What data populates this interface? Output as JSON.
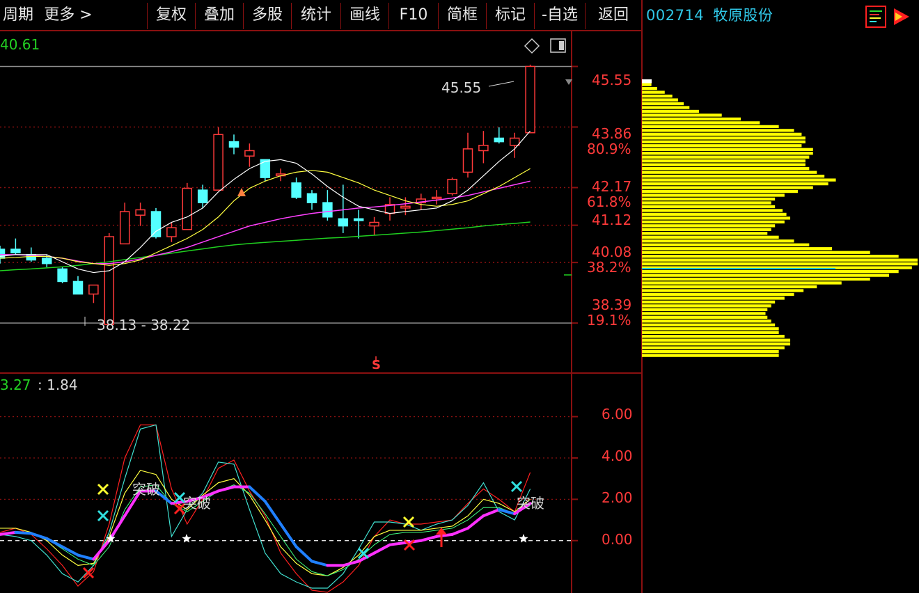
{
  "toolbar": {
    "period": "周期",
    "more": "更多 >",
    "items": [
      "复权",
      "叠加",
      "多股",
      "统计",
      "画线",
      "F10",
      "简框",
      "标记",
      "-自选",
      "返回"
    ]
  },
  "stock": {
    "code": "002714",
    "name": "牧原股份"
  },
  "main_panel": {
    "current_value": "40.61",
    "high_annotation": "45.55",
    "low_annotation": "38.13 - 38.22",
    "signal_mark": "S"
  },
  "price_axis": [
    {
      "value": "45.55",
      "pct": ""
    },
    {
      "value": "43.86",
      "pct": "80.9%"
    },
    {
      "value": "42.17",
      "pct": "61.8%"
    },
    {
      "value": "41.12",
      "pct": ""
    },
    {
      "value": "40.08",
      "pct": "38.2%"
    },
    {
      "value": "38.39",
      "pct": "19.1%"
    }
  ],
  "indicator_panel": {
    "value1": "3.27",
    "value2": ": 1.84",
    "axis": [
      "6.00",
      "4.00",
      "2.00",
      "0.00"
    ],
    "signals": [
      "突破",
      "突破",
      "突破"
    ]
  },
  "colors": {
    "up": "#ff3a3a",
    "down": "#54ffff",
    "ma5": "#ffffff",
    "ma10": "#ffff40",
    "ma20": "#ff40ff",
    "ma60": "#20d020",
    "volume_profile": "#ffff00",
    "grid": "#8a1010"
  },
  "chart_data": {
    "type": "candlestick",
    "ylim": [
      37.5,
      46.2
    ],
    "candles": [
      {
        "o": 40.45,
        "h": 40.55,
        "l": 40.05,
        "c": 40.2
      },
      {
        "o": 40.45,
        "h": 40.75,
        "l": 40.3,
        "c": 40.35
      },
      {
        "o": 40.3,
        "h": 40.5,
        "l": 40.1,
        "c": 40.15
      },
      {
        "o": 40.2,
        "h": 40.3,
        "l": 39.95,
        "c": 40.05
      },
      {
        "o": 39.9,
        "h": 39.95,
        "l": 39.5,
        "c": 39.55
      },
      {
        "o": 39.55,
        "h": 39.7,
        "l": 39.2,
        "c": 39.2
      },
      {
        "o": 39.2,
        "h": 39.45,
        "l": 38.95,
        "c": 39.45
      },
      {
        "o": 38.35,
        "h": 40.9,
        "l": 38.35,
        "c": 40.8
      },
      {
        "o": 40.6,
        "h": 41.75,
        "l": 40.6,
        "c": 41.5
      },
      {
        "o": 41.4,
        "h": 41.75,
        "l": 41.1,
        "c": 41.55
      },
      {
        "o": 41.5,
        "h": 41.6,
        "l": 40.75,
        "c": 40.8
      },
      {
        "o": 40.8,
        "h": 41.2,
        "l": 40.65,
        "c": 41.05
      },
      {
        "o": 41.0,
        "h": 42.3,
        "l": 41.0,
        "c": 42.15
      },
      {
        "o": 42.1,
        "h": 42.25,
        "l": 41.6,
        "c": 41.75
      },
      {
        "o": 42.1,
        "h": 43.85,
        "l": 42.1,
        "c": 43.65
      },
      {
        "o": 43.45,
        "h": 43.65,
        "l": 43.1,
        "c": 43.3
      },
      {
        "o": 43.05,
        "h": 43.4,
        "l": 42.75,
        "c": 43.2
      },
      {
        "o": 42.95,
        "h": 42.95,
        "l": 42.35,
        "c": 42.45
      },
      {
        "o": 42.5,
        "h": 42.7,
        "l": 42.35,
        "c": 42.55
      },
      {
        "o": 42.3,
        "h": 42.45,
        "l": 41.85,
        "c": 41.9
      },
      {
        "o": 42.0,
        "h": 42.1,
        "l": 41.55,
        "c": 41.75
      },
      {
        "o": 41.75,
        "h": 42.1,
        "l": 41.25,
        "c": 41.35
      },
      {
        "o": 41.3,
        "h": 42.25,
        "l": 40.9,
        "c": 41.1
      },
      {
        "o": 41.3,
        "h": 41.55,
        "l": 40.75,
        "c": 41.25
      },
      {
        "o": 41.1,
        "h": 41.35,
        "l": 40.85,
        "c": 41.2
      },
      {
        "o": 41.45,
        "h": 41.9,
        "l": 41.25,
        "c": 41.7
      },
      {
        "o": 41.6,
        "h": 41.9,
        "l": 41.4,
        "c": 41.65
      },
      {
        "o": 41.75,
        "h": 42.0,
        "l": 41.55,
        "c": 41.85
      },
      {
        "o": 41.9,
        "h": 42.1,
        "l": 41.7,
        "c": 41.9
      },
      {
        "o": 42.0,
        "h": 42.45,
        "l": 41.95,
        "c": 42.4
      },
      {
        "o": 42.6,
        "h": 43.7,
        "l": 42.45,
        "c": 43.25
      },
      {
        "o": 43.2,
        "h": 43.75,
        "l": 42.85,
        "c": 43.35
      },
      {
        "o": 43.55,
        "h": 43.85,
        "l": 43.4,
        "c": 43.45
      },
      {
        "o": 43.35,
        "h": 43.7,
        "l": 43.0,
        "c": 43.55
      },
      {
        "o": 43.7,
        "h": 45.6,
        "l": 43.7,
        "c": 45.55
      }
    ],
    "ma5": [
      40.25,
      40.3,
      40.3,
      40.3,
      40.1,
      39.9,
      39.8,
      39.85,
      40.1,
      40.5,
      40.95,
      41.2,
      41.35,
      41.6,
      42.05,
      42.4,
      42.7,
      42.9,
      42.95,
      42.85,
      42.55,
      42.2,
      41.9,
      41.65,
      41.55,
      41.45,
      41.5,
      41.55,
      41.6,
      41.8,
      42.1,
      42.5,
      42.9,
      43.25,
      43.75
    ],
    "ma10": [
      40.2,
      40.22,
      40.25,
      40.25,
      40.2,
      40.1,
      40.05,
      40.0,
      40.05,
      40.15,
      40.35,
      40.55,
      40.75,
      41.0,
      41.35,
      41.8,
      42.15,
      42.35,
      42.5,
      42.6,
      42.65,
      42.6,
      42.45,
      42.3,
      42.1,
      41.95,
      41.8,
      41.7,
      41.65,
      41.7,
      41.8,
      42.0,
      42.2,
      42.45,
      42.7
    ],
    "ma20": [
      40.3,
      40.3,
      40.28,
      40.25,
      40.2,
      40.12,
      40.05,
      40.05,
      40.1,
      40.18,
      40.28,
      40.38,
      40.5,
      40.65,
      40.8,
      40.95,
      41.1,
      41.2,
      41.3,
      41.38,
      41.45,
      41.5,
      41.55,
      41.6,
      41.63,
      41.67,
      41.72,
      41.77,
      41.82,
      41.88,
      41.95,
      42.05,
      42.15,
      42.25,
      42.35
    ],
    "ma60": [
      39.85,
      39.88,
      39.9,
      39.93,
      39.96,
      40.0,
      40.05,
      40.1,
      40.16,
      40.22,
      40.28,
      40.34,
      40.4,
      40.46,
      40.52,
      40.57,
      40.61,
      40.64,
      40.67,
      40.7,
      40.73,
      40.76,
      40.78,
      40.81,
      40.84,
      40.87,
      40.9,
      40.93,
      40.97,
      41.01,
      41.05,
      41.1,
      41.14,
      41.17,
      41.21
    ],
    "indicator": {
      "ylim": [
        -2.4,
        7.3
      ],
      "main": [
        0.3,
        0.4,
        0.35,
        0.1,
        -0.3,
        -0.7,
        -0.9,
        0.0,
        1.2,
        2.4,
        2.4,
        1.8,
        1.9,
        2.1,
        2.4,
        2.6,
        2.6,
        1.9,
        0.8,
        -0.3,
        -1.0,
        -1.2,
        -1.2,
        -1.0,
        -0.6,
        -0.2,
        -0.1,
        0.0,
        0.2,
        0.3,
        0.6,
        1.2,
        1.5,
        1.3,
        1.8
      ],
      "red": [
        0.4,
        0.6,
        0.3,
        -0.4,
        -1.2,
        -2.2,
        -1.5,
        0.8,
        4.0,
        5.6,
        5.6,
        2.5,
        0.8,
        2.0,
        3.5,
        3.9,
        2.4,
        1.2,
        -0.6,
        -1.6,
        -2.4,
        -2.5,
        -2.0,
        -1.2,
        0.2,
        1.0,
        0.8,
        0.8,
        0.9,
        1.0,
        1.8,
        2.5,
        2.0,
        1.4,
        3.3
      ],
      "cyan": [
        0.3,
        0.2,
        0.0,
        -0.7,
        -1.6,
        -2.0,
        -1.2,
        0.4,
        3.0,
        5.4,
        5.6,
        0.2,
        1.5,
        2.3,
        3.8,
        3.7,
        1.5,
        -0.6,
        -1.6,
        -2.0,
        -2.3,
        -2.3,
        -1.6,
        -0.4,
        0.9,
        0.9,
        0.8,
        0.5,
        0.8,
        1.0,
        1.7,
        2.8,
        1.4,
        1.0,
        2.5
      ],
      "yellow": [
        0.6,
        0.6,
        0.4,
        0.0,
        -0.7,
        -1.2,
        -1.1,
        0.2,
        2.3,
        3.4,
        3.2,
        2.0,
        1.5,
        2.2,
        2.8,
        3.0,
        2.2,
        1.0,
        -0.3,
        -1.1,
        -1.6,
        -1.7,
        -1.3,
        -0.7,
        0.2,
        0.5,
        0.5,
        0.5,
        0.6,
        0.7,
        1.2,
        2.0,
        1.8,
        1.4,
        2.0
      ],
      "green": [
        0.3,
        0.4,
        0.4,
        0.1,
        -0.4,
        -0.9,
        -1.2,
        -0.3,
        1.5,
        2.6,
        2.7,
        1.8,
        1.4,
        1.9,
        2.4,
        2.7,
        2.3,
        1.3,
        0.2,
        -0.9,
        -1.5,
        -1.7,
        -1.4,
        -0.9,
        -0.2,
        0.3,
        0.4,
        0.4,
        0.5,
        0.6,
        1.0,
        1.6,
        1.6,
        1.3,
        1.7
      ]
    },
    "volume_profile": [
      0.03,
      0.05,
      0.08,
      0.12,
      0.16,
      0.19,
      0.22,
      0.25,
      0.3,
      0.42,
      0.52,
      0.62,
      0.72,
      0.8,
      0.84,
      0.86,
      0.86,
      0.84,
      0.9,
      0.9,
      0.88,
      0.86,
      0.86,
      0.88,
      0.92,
      0.96,
      1.02,
      0.98,
      0.9,
      0.82,
      0.75,
      0.7,
      0.68,
      0.7,
      0.74,
      0.76,
      0.78,
      0.75,
      0.7,
      0.68,
      0.66,
      0.72,
      0.8,
      0.88,
      1.0,
      1.2,
      1.35,
      1.45,
      1.45,
      1.42,
      1.35,
      1.3,
      1.2,
      1.05,
      0.92,
      0.85,
      0.8,
      0.75,
      0.7,
      0.68,
      0.66,
      0.65,
      0.66,
      0.68,
      0.7,
      0.72,
      0.72,
      0.75,
      0.78,
      0.78,
      0.75,
      0.72,
      0.72
    ]
  }
}
